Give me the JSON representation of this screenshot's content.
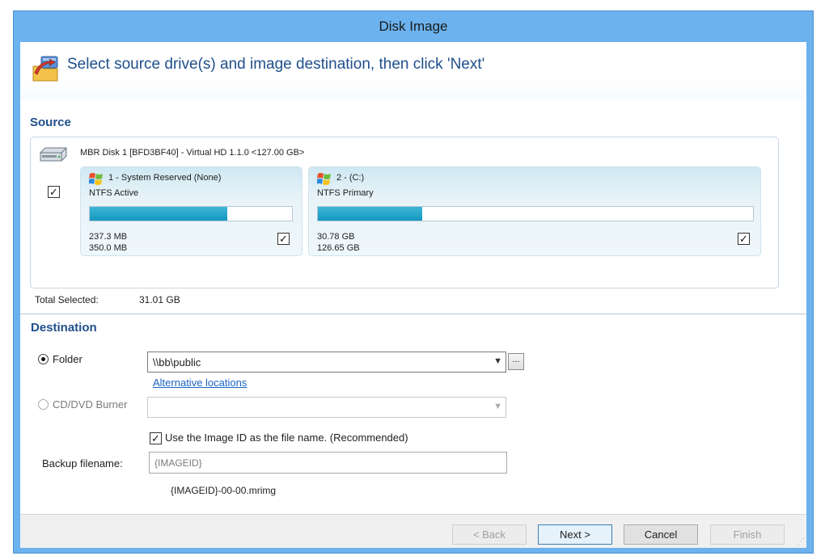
{
  "window": {
    "title": "Disk Image"
  },
  "header": {
    "instruction": "Select source drive(s) and image destination, then click 'Next'"
  },
  "source": {
    "section_title": "Source",
    "disk_label": "MBR Disk 1 [BFD3BF40] - Virtual HD 1.1.0  <127.00 GB>",
    "disk_checked": "✓",
    "partitions": [
      {
        "name": "1 - System Reserved (None)",
        "fs": "NTFS Active",
        "used": "237.3 MB",
        "total": "350.0 MB",
        "fill_fraction": 0.68,
        "checked": "✓"
      },
      {
        "name": "2 -  (C:)",
        "fs": "NTFS Primary",
        "used": "30.78 GB",
        "total": "126.65 GB",
        "fill_fraction": 0.24,
        "checked": "✓"
      }
    ],
    "total_label": "Total Selected:",
    "total_value": "31.01 GB"
  },
  "destination": {
    "section_title": "Destination",
    "folder_label": "Folder",
    "folder_value": "\\\\bb\\public",
    "browse_label": "...",
    "alt_link": "Alternative locations",
    "cd_label": "CD/DVD Burner",
    "use_imageid_label": "Use the Image ID as the file name.  (Recommended)",
    "use_imageid_checked": "✓",
    "backup_label": "Backup filename:",
    "backup_value": "{IMAGEID}",
    "preview_filename": "{IMAGEID}-00-00.mrimg"
  },
  "footer": {
    "back": "< Back",
    "next": "Next >",
    "cancel": "Cancel",
    "finish": "Finish"
  },
  "colors": {
    "title_blue": "#6bb2ee",
    "accent_text": "#1f4f8c",
    "bar_fill": "#1aa3cb",
    "link": "#1a62c6"
  }
}
